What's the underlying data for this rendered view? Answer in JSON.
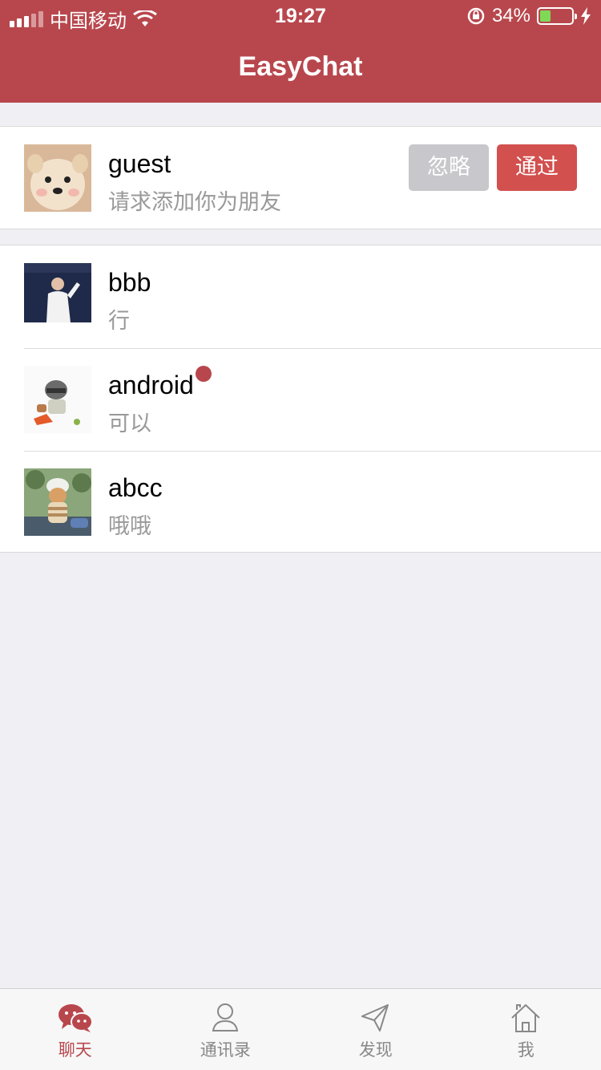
{
  "status_bar": {
    "carrier": "中国移动",
    "time": "19:27",
    "battery_percent": "34%",
    "battery_level": 0.34
  },
  "header": {
    "title": "EasyChat"
  },
  "friend_request": {
    "name": "guest",
    "message": "请求添加你为朋友",
    "ignore_label": "忽略",
    "accept_label": "通过"
  },
  "chats": [
    {
      "name": "bbb",
      "last_message": "行",
      "unread": false
    },
    {
      "name": "android",
      "last_message": "可以",
      "unread": true
    },
    {
      "name": "abcc",
      "last_message": "哦哦",
      "unread": false
    }
  ],
  "tabs": [
    {
      "label": "聊天",
      "icon": "chat-bubbles-icon",
      "active": true
    },
    {
      "label": "通讯录",
      "icon": "contacts-icon",
      "active": false
    },
    {
      "label": "发现",
      "icon": "paper-plane-icon",
      "active": false
    },
    {
      "label": "我",
      "icon": "home-icon",
      "active": false
    }
  ],
  "colors": {
    "brand": "#b8474d",
    "accept": "#d2504e",
    "ignore": "#c7c7cc",
    "background": "#efeff4"
  }
}
